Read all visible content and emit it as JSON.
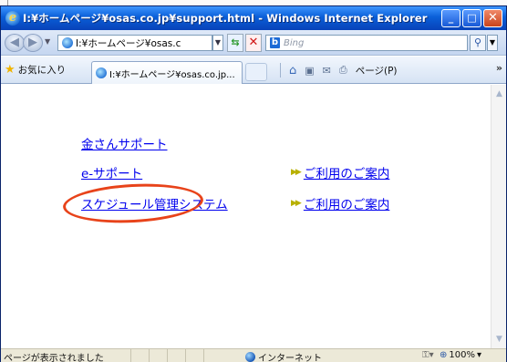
{
  "window": {
    "title": "I:¥ホームページ¥osas.co.jp¥support.html - Windows Internet Explorer",
    "buttons": {
      "minimize": "_",
      "maximize": "□",
      "close": "✕"
    }
  },
  "address_bar": {
    "url": "I:¥ホームページ¥osas.c",
    "search_placeholder": "Bing"
  },
  "toolbar": {
    "favorites_label": "お気に入り",
    "tab_title": "I:¥ホームページ¥osas.co.jp...",
    "page_menu": "ページ(P)"
  },
  "content": {
    "link_kin": "金さんサポート",
    "link_esupport": "e-サポート",
    "link_schedule": "スケジュール管理システム",
    "guide_1": "ご利用のご案内",
    "guide_2": "ご利用のご案内"
  },
  "status_bar": {
    "status_text": "ページが表示されました",
    "zone": "インターネット",
    "zoom": "100%"
  },
  "colors": {
    "link": "#0000ee",
    "highlight": "#e8431a",
    "titlebar": "#0a5fd8"
  }
}
